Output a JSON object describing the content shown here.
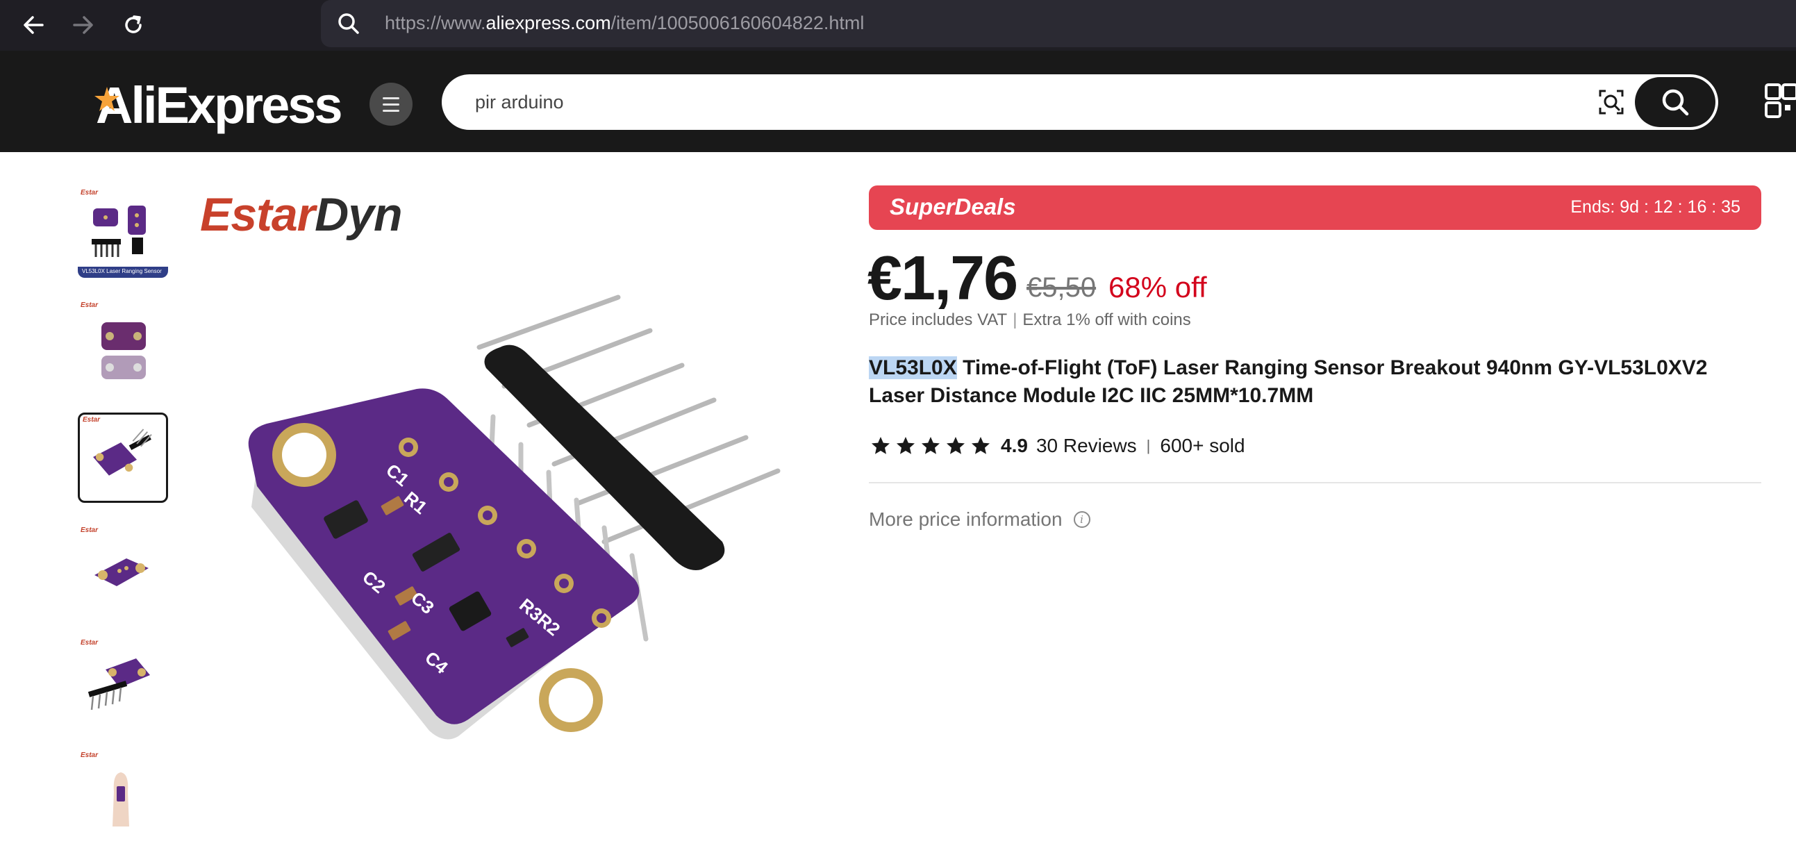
{
  "browser": {
    "url_prefix": "https://www.",
    "url_domain": "aliexpress.com",
    "url_path": "/item/1005006160604822.html"
  },
  "header": {
    "logo_text": "AliExpress",
    "search_value": "pir arduino"
  },
  "gallery": {
    "brand": "EstarDyn",
    "brand_part1": "Estar",
    "brand_part2": "Dyn",
    "thumbnails": [
      {
        "caption": "VL53L0X Laser Ranging Sensor",
        "selected": false
      },
      {
        "caption": "",
        "selected": false
      },
      {
        "caption": "",
        "selected": true
      },
      {
        "caption": "",
        "selected": false
      },
      {
        "caption": "",
        "selected": false
      },
      {
        "caption": "",
        "selected": false
      }
    ]
  },
  "deal": {
    "label": "SuperDeals",
    "timer": "Ends: 9d : 12 : 16 : 35",
    "color": "#e64552"
  },
  "pricing": {
    "price": "€1,76",
    "original_price": "€5,50",
    "discount": "68% off",
    "vat_note": "Price includes VAT",
    "coins_note": "Extra 1% off with coins"
  },
  "product": {
    "title_highlight": "VL53L0X",
    "title_rest": " Time-of-Flight (ToF) Laser Ranging Sensor Breakout 940nm GY-VL53L0XV2 Laser Distance Module I2C IIC 25MM*10.7MM",
    "rating": "4.9",
    "reviews": "30 Reviews",
    "sold": "600+ sold",
    "stars": 5
  },
  "more_price_info": "More price information",
  "colors": {
    "header_bg": "#191919",
    "discount": "#d3031c",
    "pcb": "#5b2a86"
  }
}
